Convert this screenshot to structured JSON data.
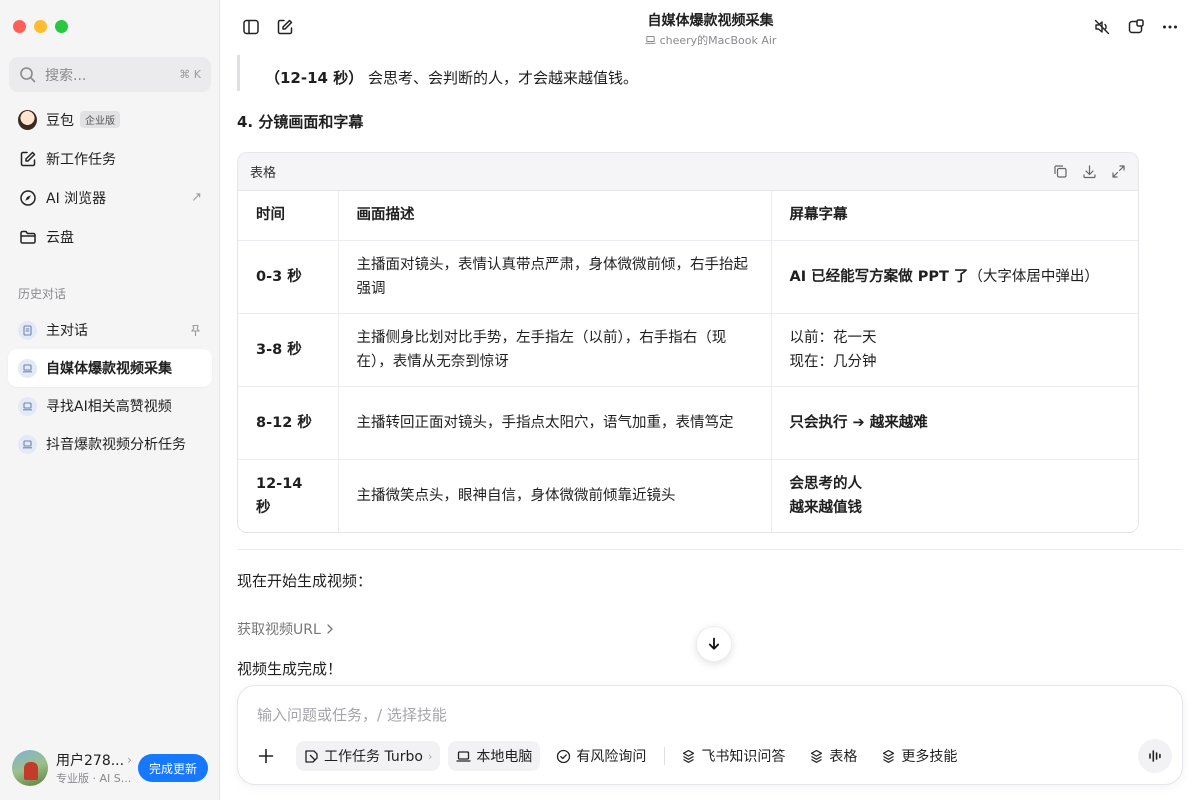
{
  "sidebar": {
    "search": {
      "placeholder": "搜索...",
      "shortcut": "⌘ K"
    },
    "nav": [
      {
        "label": "豆包",
        "badge": "企业版",
        "icon": "doubao-avatar"
      },
      {
        "label": "新工作任务",
        "icon": "edit-icon"
      },
      {
        "label": "AI 浏览器",
        "icon": "compass-icon",
        "trailing": "↗"
      },
      {
        "label": "云盘",
        "icon": "folder-icon"
      }
    ],
    "history_label": "历史对话",
    "history": [
      {
        "label": "主对话",
        "pinned": true
      },
      {
        "label": "自媒体爆款视频采集",
        "active": true
      },
      {
        "label": "寻找AI相关高赞视频"
      },
      {
        "label": "抖音爆款视频分析任务"
      }
    ],
    "user": {
      "name": "用户278...",
      "sub": "专业版 · AI S...",
      "update_button": "完成更新"
    }
  },
  "topbar": {
    "title": "自媒体爆款视频采集",
    "device": "cheery的MacBook Air"
  },
  "content": {
    "quote_line_time": "（12-14 秒）",
    "quote_line_text": "会思考、会判断的人，才会越来越值钱。",
    "heading": "4. 分镜画面和字幕",
    "table": {
      "title": "表格",
      "columns": [
        "时间",
        "画面描述",
        "屏幕字幕"
      ],
      "rows": [
        {
          "time": "0-3 秒",
          "desc": "主播面对镜头，表情认真带点严肃，身体微微前倾，右手抬起强调",
          "sub_bold": "AI 已经能写方案做 PPT 了",
          "sub_normal": "（大字体居中弹出）"
        },
        {
          "time": "3-8 秒",
          "desc": "主播侧身比划对比手势，左手指左（以前），右手指右（现在），表情从无奈到惊讶",
          "sub_line1": "以前：花一天",
          "sub_line2": "现在：几分钟"
        },
        {
          "time": "8-12 秒",
          "desc": "主播转回正面对镜头，手指点太阳穴，语气加重，表情笃定",
          "sub_bold": "只会执行 ➔ 越来越难"
        },
        {
          "time": "12-14 秒",
          "desc": "主播微笑点头，眼神自信，身体微微前倾靠近镜头",
          "sub_line1": "会思考的人",
          "sub_line2": "越来越值钱"
        }
      ]
    },
    "p_generate": "现在开始生成视频：",
    "tool_link": "获取视频URL",
    "p_done": "视频生成完成！"
  },
  "composer": {
    "placeholder": "输入问题或任务，/ 选择技能",
    "chips": [
      "工作任务 Turbo",
      "本地电脑",
      "有风险询问",
      "飞书知识问答",
      "表格",
      "更多技能"
    ]
  },
  "colors": {
    "accent": "#1677ff",
    "sidebar_bg": "#f5f5f6"
  }
}
